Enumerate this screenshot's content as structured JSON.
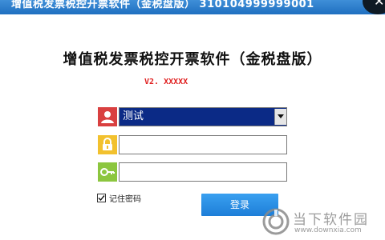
{
  "window": {
    "title": "增值税发票税控开票软件（金税盘版） 310104999999001",
    "close_glyph": "✕"
  },
  "app": {
    "title": "增值税发票税控开票软件（金税盘版）",
    "version": "V2. XXXXX"
  },
  "form": {
    "user_select_value": "测试",
    "password_value": "",
    "cert_password_value": "",
    "remember_label": "记住密码",
    "remember_checked": true,
    "login_label": "登录"
  },
  "icons": {
    "user": "user-icon",
    "password": "lock-icon",
    "cert": "key-icon"
  },
  "colors": {
    "titlebar": "#1f6fc0",
    "user_icon_bg": "#d94040",
    "lock_icon_bg": "#f2c12e",
    "key_icon_bg": "#8cc63f",
    "select_bg": "#0b2a86",
    "version_text": "#e02020",
    "login_bg": "#1d7ed8"
  },
  "watermark": {
    "name": "当下软件园",
    "url": "www.downxia.com"
  }
}
